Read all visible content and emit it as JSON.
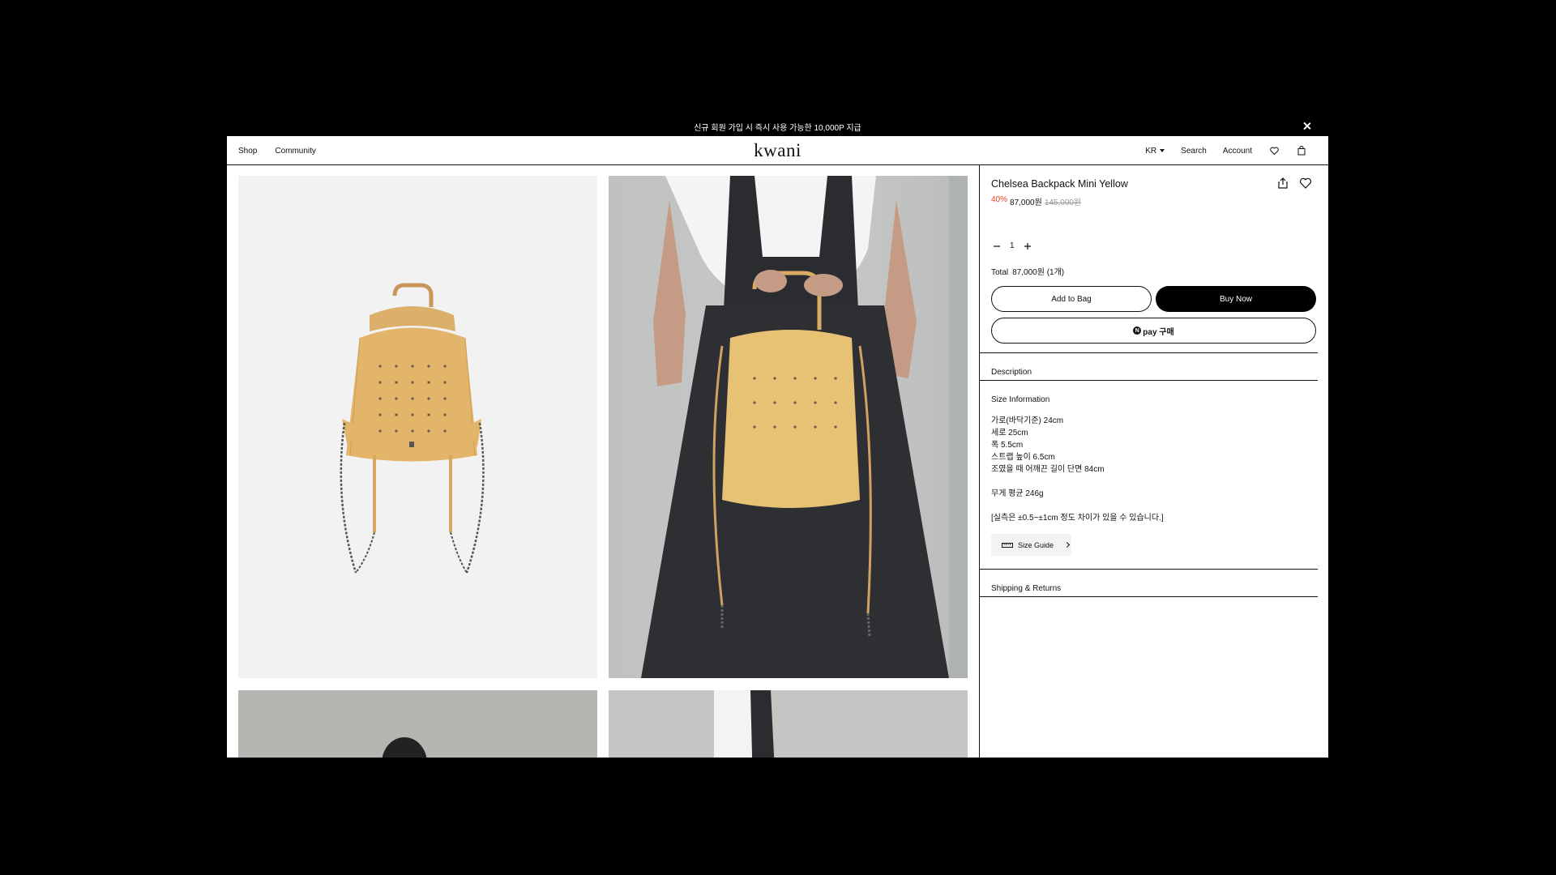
{
  "announcement": {
    "text": "신규 회원 가입 시 즉시 사용 가능한 10,000P 지급"
  },
  "header": {
    "nav_left": [
      "Shop",
      "Community"
    ],
    "logo": "kwani",
    "locale": "KR",
    "search": "Search",
    "account": "Account",
    "icons": [
      "heart-icon",
      "bag-icon"
    ]
  },
  "product": {
    "name": "Chelsea Backpack Mini Yellow",
    "discount": "40%",
    "price": "87,000원",
    "original_price": "145,000원",
    "quantity": "1",
    "total_label": "Total",
    "total_value": "87,000원 (1개)",
    "add_to_bag": "Add to Bag",
    "buy_now": "Buy Now",
    "npay_logo": "N",
    "npay_label": "pay 구매"
  },
  "sections": {
    "description": "Description",
    "size_information": "Size Information",
    "shipping_returns": "Shipping & Returns"
  },
  "size_info": {
    "lines": [
      "가로(바닥기준) 24cm",
      "세로 25cm",
      "폭 5.5cm",
      "스트랩 높이 6.5cm",
      "조였을 때 어깨끈 길이 단면 84cm",
      "",
      "무게 평균 246g",
      "",
      "[실측은 ±0.5~±1cm 정도 차이가 있을 수 있습니다.]"
    ],
    "size_guide": "Size Guide"
  },
  "colors": {
    "accent_discount": "#e5421f",
    "bag_yellow": "#e2b56a"
  }
}
